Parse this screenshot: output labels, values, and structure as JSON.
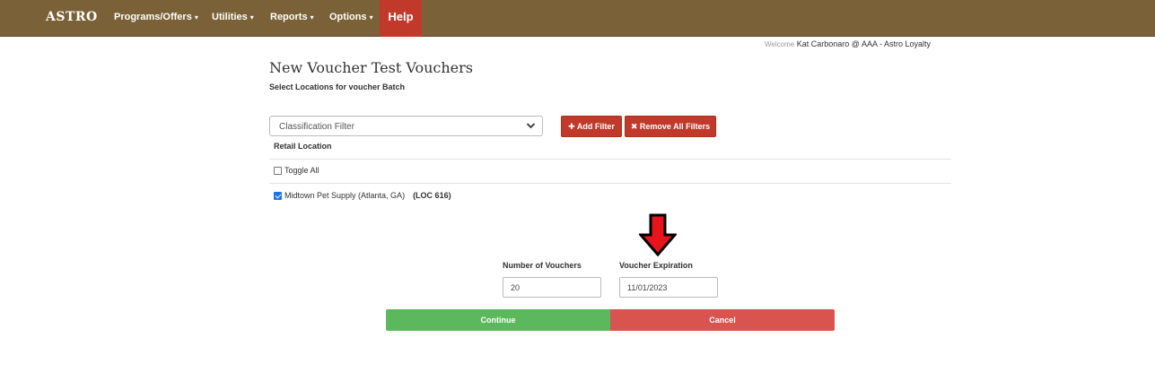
{
  "nav": {
    "brand": "ASTRO",
    "items": [
      {
        "label": "Programs/Offers",
        "caret": "▾"
      },
      {
        "label": "Utilities",
        "caret": "▾"
      },
      {
        "label": "Reports",
        "caret": "▾"
      },
      {
        "label": "Options",
        "caret": "▾"
      }
    ],
    "help": "Help"
  },
  "welcome": {
    "prefix": "Welcome",
    "user": "Kat Carbonaro",
    "at": "@",
    "org": "AAA - Astro Loyalty"
  },
  "page": {
    "title": "New Voucher Test Vouchers",
    "subtitle": "Select Locations for voucher Batch"
  },
  "filter": {
    "select_value": "Classification Filter",
    "add_label": "Add Filter",
    "remove_label": "Remove All Filters"
  },
  "locations": {
    "column_header": "Retail Location",
    "toggle_all_label": "Toggle All",
    "toggle_all_checked": false,
    "items": [
      {
        "name": "Midtown Pet Supply (Atlanta, GA)",
        "code": "(LOC 616)",
        "checked": true
      }
    ]
  },
  "form": {
    "number_label": "Number of Vouchers",
    "number_value": "20",
    "expiration_label": "Voucher Expiration",
    "expiration_value": "11/01/2023"
  },
  "actions": {
    "continue_label": "Continue",
    "cancel_label": "Cancel"
  },
  "colors": {
    "navbar": "#7a6137",
    "help": "#c0392b",
    "continue": "#5cb85c",
    "cancel": "#d9534f",
    "annotation_arrow": "#e8141b"
  }
}
